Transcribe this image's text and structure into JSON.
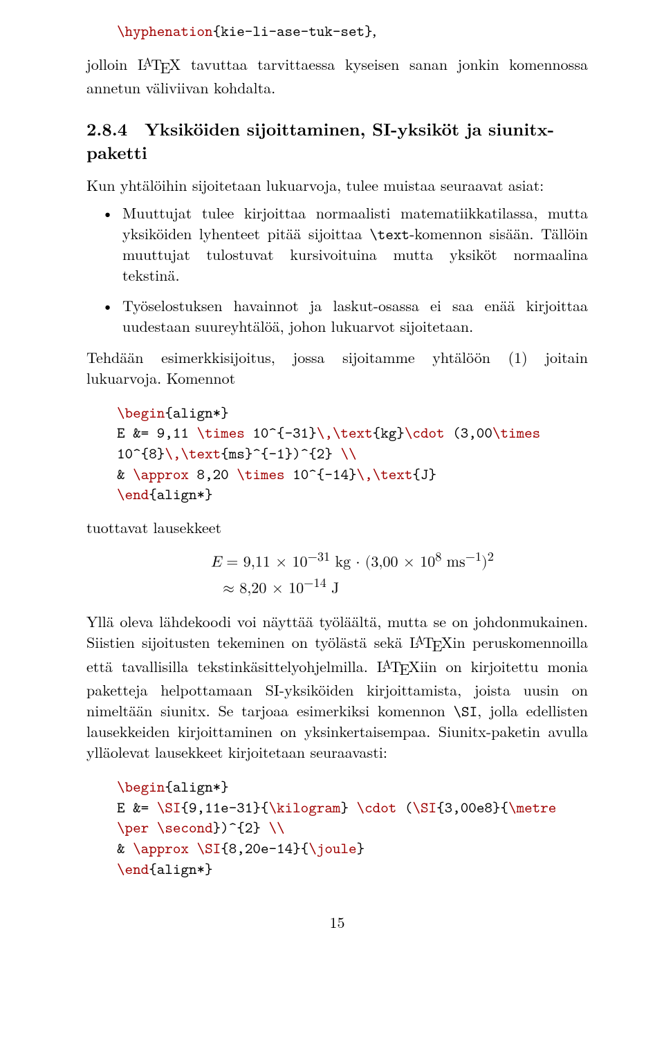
{
  "top_code": {
    "line1_a": "\\hyphenation",
    "line1_b": "{kie-li-ase-tuk-set}",
    "after": ","
  },
  "p_intro": {
    "a": "jolloin ",
    "b": " tavuttaa tarvittaessa kyseisen sanan jonkin komennossa annetun väliviivan kohdalta."
  },
  "heading": "2.8.4 Yksiköiden sijoittaminen, SI-yksiköt ja siunitx-paketti",
  "p_after_heading": "Kun yhtälöihin sijoitetaan lukuarvoja, tulee muistaa seuraavat asiat:",
  "bullet1": {
    "a": "Muuttujat tulee kirjoittaa normaalisti matematiikkatilassa, mutta yksiköiden lyhenteet pitää sijoittaa ",
    "cmd": "\\text",
    "b": "-komennon sisään. Tällöin muuttujat tulostuvat kursivoituina mutta yksiköt normaalina tekstinä."
  },
  "bullet2": "Työselostuksen havainnot ja laskut-osassa ei saa enää kirjoittaa uudestaan suureyhtälöä, johon lukuarvot sijoitetaan.",
  "p_before_code1": "Tehdään esimerkkisijoitus, jossa sijoitamme yhtälöön (1) joitain lukuarvoja. Komennot",
  "code1": {
    "l1a": "\\begin",
    "l1b": "{align*}",
    "l2a": "E &= 9,11 ",
    "l2b": "\\times",
    "l2c": " 10^{-31}",
    "l2d": "\\,\\text",
    "l2e": "{kg}",
    "l2f": "\\cdot",
    "l2g": " (3,00",
    "l2h": "\\times",
    "l3a": "10^{8}",
    "l3b": "\\,\\text",
    "l3c": "{ms}^{-1})^{2} ",
    "l3d": "\\\\",
    "l4a": "& ",
    "l4b": "\\approx",
    "l4c": " 8,20 ",
    "l4d": "\\times",
    "l4e": " 10^{-14}",
    "l4f": "\\,\\text",
    "l4g": "{J}",
    "l5a": "\\end",
    "l5b": "{align*}"
  },
  "p_tuottavat": "tuottavat lausekkeet",
  "eq": {
    "row1_a": "E",
    "row1_eq": " = 9,11 × 10",
    "row1_exp1": "−31",
    "row1_mid": " kg · (3,00 × 10",
    "row1_exp2": "8",
    "row1_ms": " ms",
    "row1_exp3": "−1",
    "row1_close": ")",
    "row1_exp4": "2",
    "row2_a": "≈ 8,20 × 10",
    "row2_exp": "−14",
    "row2_b": " J"
  },
  "p_big": {
    "a": "Yllä oleva lähdekoodi voi näyttää työläältä, mutta se on johdonmukainen. Siistien sijoitusten tekeminen on työlästä sekä ",
    "b": "in peruskomennoilla että tavallisilla tekstinkäsittelyohjelmilla. ",
    "c": "iin on kirjoitettu monia paketteja helpottamaan SI-yksiköiden kirjoittamista, joista uusin on nimeltään siunitx. Se tarjoaa esimerkiksi komennon ",
    "cmd": "\\SI",
    "d": ", jolla edellisten lausekkeiden kirjoittaminen on yksinkertaisempaa. Siunitx-paketin avulla ylläolevat lausekkeet kirjoitetaan seuraavasti:"
  },
  "code2": {
    "l1a": "\\begin",
    "l1b": "{align*}",
    "l2a": "E &= ",
    "l2b": "\\SI",
    "l2c": "{9,11e-31}{",
    "l2d": "\\kilogram",
    "l2e": "} ",
    "l2f": "\\cdot",
    "l2g": " (",
    "l2h": "\\SI",
    "l2i": "{3,00e8}{",
    "l2j": "\\metre",
    "l3a": "\\per",
    "l3b": " ",
    "l3c": "\\second",
    "l3d": "})^{2} ",
    "l3e": "\\\\",
    "l4a": "& ",
    "l4b": "\\approx",
    "l4c": " ",
    "l4d": "\\SI",
    "l4e": "{8,20e-14}{",
    "l4f": "\\joule",
    "l4g": "}",
    "l5a": "\\end",
    "l5b": "{align*}"
  },
  "page_number": "15"
}
